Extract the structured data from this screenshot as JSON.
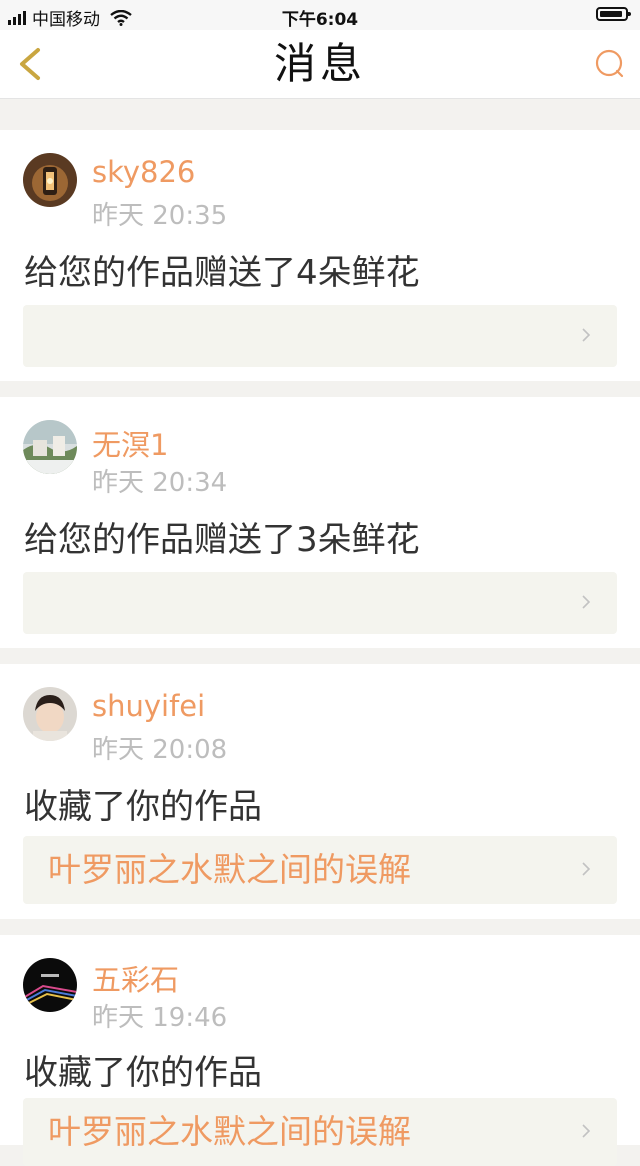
{
  "status_bar": {
    "carrier": "中国移动",
    "time": "下午6:04"
  },
  "nav": {
    "title": "消息"
  },
  "colors": {
    "accent": "#ef9a62",
    "back": "#c9a640",
    "card_attach_bg": "#f4f4ee",
    "page_bg": "#f3f2ef"
  },
  "messages": [
    {
      "username": "sky826",
      "time": "昨天 20:35",
      "text": "给您的作品赠送了4朵鲜花",
      "work_title": ""
    },
    {
      "username": "无溟1",
      "time": "昨天 20:34",
      "text": "给您的作品赠送了3朵鲜花",
      "work_title": ""
    },
    {
      "username": "shuyifei",
      "time": "昨天 20:08",
      "text": "收藏了你的作品",
      "work_title": "叶罗丽之水默之间的误解"
    },
    {
      "username": "五彩石",
      "time": "昨天 19:46",
      "text": "收藏了你的作品",
      "work_title": "叶罗丽之水默之间的误解"
    }
  ]
}
